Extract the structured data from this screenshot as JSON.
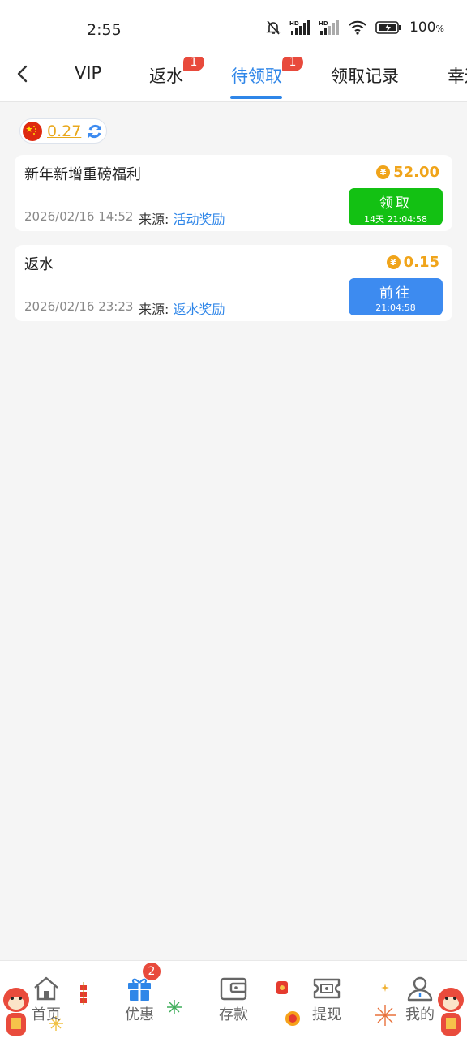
{
  "status": {
    "time": "2:55",
    "battery": "100",
    "battery_unit": "%",
    "icons": [
      "bell-off-icon",
      "signal-hd-icon",
      "signal-hd-icon",
      "wifi-icon",
      "battery-icon"
    ]
  },
  "nav": {
    "tabs": [
      {
        "label": "VIP",
        "badge": ""
      },
      {
        "label": "返水",
        "badge": "1"
      },
      {
        "label": "待领取",
        "badge": "1"
      },
      {
        "label": "领取记录",
        "badge": ""
      },
      {
        "label": "幸运",
        "badge": ""
      }
    ],
    "active_tab": 2
  },
  "balance": {
    "amount": "0.27"
  },
  "rewards": [
    {
      "title": "新年新增重磅福利",
      "coin": "¥",
      "amount": "52.00",
      "date": "2026/02/16 14:52",
      "source_label": "来源:",
      "source": "活动奖励",
      "button": "领取",
      "button_sub": "14天 21:04:58"
    },
    {
      "title": "返水",
      "coin": "¥",
      "amount": "0.15",
      "date": "2026/02/16 23:23",
      "source_label": "来源:",
      "source": "返水奖励",
      "button": "前往",
      "button_sub": "21:04:58"
    }
  ],
  "bottom_nav": {
    "items": [
      {
        "label": "首页",
        "icon": "home-icon"
      },
      {
        "label": "优惠",
        "icon": "gift-icon",
        "badge": "2"
      },
      {
        "label": "存款",
        "icon": "wallet-icon"
      },
      {
        "label": "提现",
        "icon": "withdraw-icon"
      },
      {
        "label": "我的",
        "icon": "user-icon"
      }
    ],
    "active": 1
  },
  "colors": {
    "accent": "#2f86e8",
    "gold": "#f0a41a",
    "green": "#13c113",
    "badge": "#e84a3c"
  }
}
